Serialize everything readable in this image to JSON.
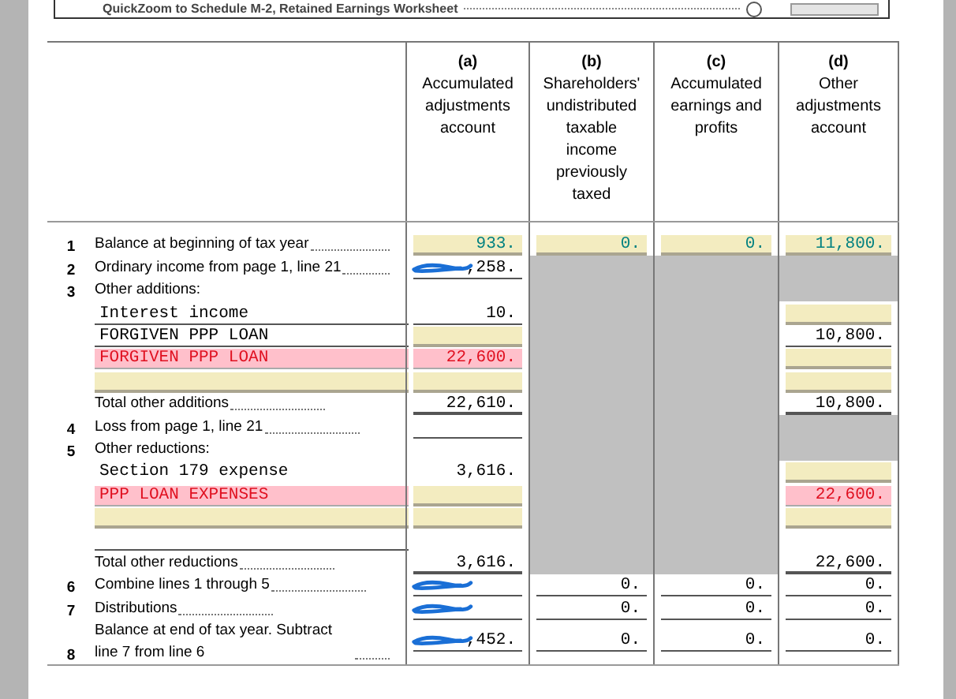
{
  "quickzoom": {
    "label": "QuickZoom to Schedule M-2, Retained Earnings Worksheet",
    "radio_selected": false
  },
  "columns": [
    {
      "letter": "(a)",
      "title": "Accumulated adjustments account"
    },
    {
      "letter": "(b)",
      "title": "Shareholders' undistributed taxable income previously taxed"
    },
    {
      "letter": "(c)",
      "title": "Accumulated earnings and profits"
    },
    {
      "letter": "(d)",
      "title": "Other adjustments account"
    }
  ],
  "rows": [
    {
      "kind": "line",
      "number": "1",
      "label": "Balance at beginning of tax year",
      "cells": [
        {
          "kind": "input",
          "value": "933."
        },
        {
          "kind": "input",
          "value": "0."
        },
        {
          "kind": "input",
          "value": "0."
        },
        {
          "kind": "input",
          "value": "11,800."
        }
      ]
    },
    {
      "kind": "line",
      "number": "2",
      "label": "Ordinary income from page 1, line 21",
      "cells": [
        {
          "kind": "output",
          "value": ",258.",
          "redacted": true
        },
        {
          "kind": "shaded"
        },
        {
          "kind": "shaded"
        },
        {
          "kind": "shaded"
        }
      ]
    },
    {
      "kind": "heading",
      "number": "3",
      "label": "Other additions:",
      "cells": [
        {
          "kind": "none"
        },
        {
          "kind": "shaded"
        },
        {
          "kind": "shaded"
        },
        {
          "kind": "shaded"
        }
      ]
    },
    {
      "kind": "entry",
      "field": {
        "kind": "output",
        "value": "Interest income"
      },
      "cells": [
        {
          "kind": "output",
          "value": "10."
        },
        {
          "kind": "shaded"
        },
        {
          "kind": "shaded"
        },
        {
          "kind": "input"
        }
      ]
    },
    {
      "kind": "entry",
      "field": {
        "kind": "output",
        "value": "FORGIVEN PPP LOAN"
      },
      "cells": [
        {
          "kind": "input"
        },
        {
          "kind": "shaded"
        },
        {
          "kind": "shaded"
        },
        {
          "kind": "output",
          "value": "10,800."
        }
      ]
    },
    {
      "kind": "entry",
      "field": {
        "kind": "input",
        "value": "FORGIVEN PPP LOAN",
        "flagged": true
      },
      "cells": [
        {
          "kind": "input",
          "value": "22,600.",
          "flagged": true
        },
        {
          "kind": "shaded"
        },
        {
          "kind": "shaded"
        },
        {
          "kind": "input"
        }
      ]
    },
    {
      "kind": "entry",
      "field": {
        "kind": "input"
      },
      "cells": [
        {
          "kind": "input"
        },
        {
          "kind": "shaded"
        },
        {
          "kind": "shaded"
        },
        {
          "kind": "input"
        }
      ]
    },
    {
      "kind": "total",
      "label": "Total other additions",
      "cells": [
        {
          "kind": "output",
          "value": "22,610."
        },
        {
          "kind": "shaded"
        },
        {
          "kind": "shaded"
        },
        {
          "kind": "output",
          "value": "10,800."
        }
      ]
    },
    {
      "kind": "line",
      "number": "4",
      "label": "Loss from page 1, line 21",
      "cells": [
        {
          "kind": "output"
        },
        {
          "kind": "shaded"
        },
        {
          "kind": "shaded"
        },
        {
          "kind": "shaded"
        }
      ]
    },
    {
      "kind": "heading",
      "number": "5",
      "label": "Other reductions:",
      "cells": [
        {
          "kind": "none"
        },
        {
          "kind": "shaded"
        },
        {
          "kind": "shaded"
        },
        {
          "kind": "shaded"
        }
      ]
    },
    {
      "kind": "entry",
      "field": {
        "kind": "plain",
        "value": "Section 179 expense"
      },
      "cells": [
        {
          "kind": "plain",
          "value": "3,616."
        },
        {
          "kind": "shaded"
        },
        {
          "kind": "shaded"
        },
        {
          "kind": "input"
        }
      ]
    },
    {
      "kind": "entry",
      "field": {
        "kind": "input",
        "value": "PPP LOAN EXPENSES",
        "flagged": true
      },
      "cells": [
        {
          "kind": "input"
        },
        {
          "kind": "shaded"
        },
        {
          "kind": "shaded"
        },
        {
          "kind": "input",
          "value": "22,600.",
          "flagged": true
        }
      ]
    },
    {
      "kind": "entry",
      "field": {
        "kind": "input"
      },
      "cells": [
        {
          "kind": "input"
        },
        {
          "kind": "shaded"
        },
        {
          "kind": "shaded"
        },
        {
          "kind": "input"
        }
      ]
    },
    {
      "kind": "entry",
      "field": {
        "kind": "output"
      },
      "cells": [
        {
          "kind": "none"
        },
        {
          "kind": "shaded"
        },
        {
          "kind": "shaded"
        },
        {
          "kind": "none"
        }
      ]
    },
    {
      "kind": "total",
      "label": "Total other reductions",
      "cells": [
        {
          "kind": "output",
          "value": "3,616."
        },
        {
          "kind": "shaded"
        },
        {
          "kind": "shaded"
        },
        {
          "kind": "output",
          "value": "22,600."
        }
      ]
    },
    {
      "kind": "line",
      "number": "6",
      "label": "Combine lines 1 through 5",
      "cells": [
        {
          "kind": "output",
          "redacted": true
        },
        {
          "kind": "output",
          "value": "0."
        },
        {
          "kind": "output",
          "value": "0."
        },
        {
          "kind": "output",
          "value": "0."
        }
      ]
    },
    {
      "kind": "line",
      "number": "7",
      "label": "Distributions",
      "cells": [
        {
          "kind": "output",
          "redacted": true
        },
        {
          "kind": "output",
          "value": "0."
        },
        {
          "kind": "output",
          "value": "0."
        },
        {
          "kind": "output",
          "value": "0."
        }
      ]
    },
    {
      "kind": "line",
      "number": "8",
      "label": "Balance at end of tax year. Subtract line 7 from line 6",
      "cells": [
        {
          "kind": "output",
          "value": ",452.",
          "redacted": true
        },
        {
          "kind": "output",
          "value": "0."
        },
        {
          "kind": "output",
          "value": "0."
        },
        {
          "kind": "output",
          "value": "0."
        }
      ]
    }
  ]
}
